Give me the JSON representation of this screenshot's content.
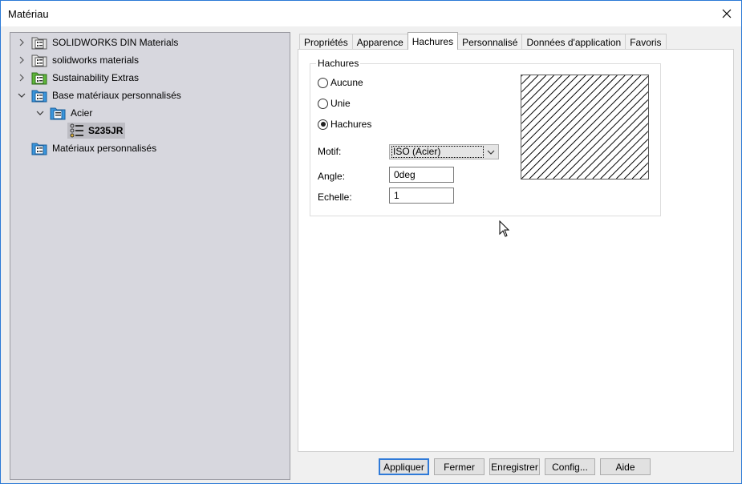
{
  "window": {
    "title": "Matériau"
  },
  "tree": {
    "items": [
      {
        "label": "SOLIDWORKS DIN Materials",
        "expanded": false,
        "icon": "library-folder-icon"
      },
      {
        "label": "solidworks materials",
        "expanded": false,
        "icon": "library-folder-icon"
      },
      {
        "label": "Sustainability Extras",
        "expanded": false,
        "icon": "green-library-folder-icon"
      },
      {
        "label": "Base matériaux personnalisés",
        "expanded": true,
        "icon": "blue-library-folder-icon"
      },
      {
        "label": "Acier",
        "expanded": true,
        "icon": "blue-category-folder-icon"
      },
      {
        "label": "S235JR",
        "selected": true,
        "icon": "material-list-icon"
      },
      {
        "label": "Matériaux personnalisés",
        "icon": "blue-library-folder-icon"
      }
    ]
  },
  "tabs": [
    {
      "label": "Propriétés"
    },
    {
      "label": "Apparence"
    },
    {
      "label": "Hachures",
      "active": true
    },
    {
      "label": "Personnalisé"
    },
    {
      "label": "Données d'application"
    },
    {
      "label": "Favoris"
    }
  ],
  "hatch": {
    "group_title": "Hachures",
    "options": [
      {
        "label": "Aucune",
        "checked": false
      },
      {
        "label": "Unie",
        "checked": false
      },
      {
        "label": "Hachures",
        "checked": true
      }
    ],
    "motif_label": "Motif:",
    "motif_value": "ISO (Acier)",
    "angle_label": "Angle:",
    "angle_value": "0deg",
    "scale_label": "Echelle:",
    "scale_value": "1"
  },
  "buttons": {
    "apply": "Appliquer",
    "close": "Fermer",
    "save": "Enregistrer",
    "config": "Config...",
    "help": "Aide"
  },
  "colors": {
    "tree_bg": "#d7d7de",
    "accent": "#2f7ad8",
    "folder_blue": "#2a8ad4",
    "folder_green": "#4caf2a"
  }
}
